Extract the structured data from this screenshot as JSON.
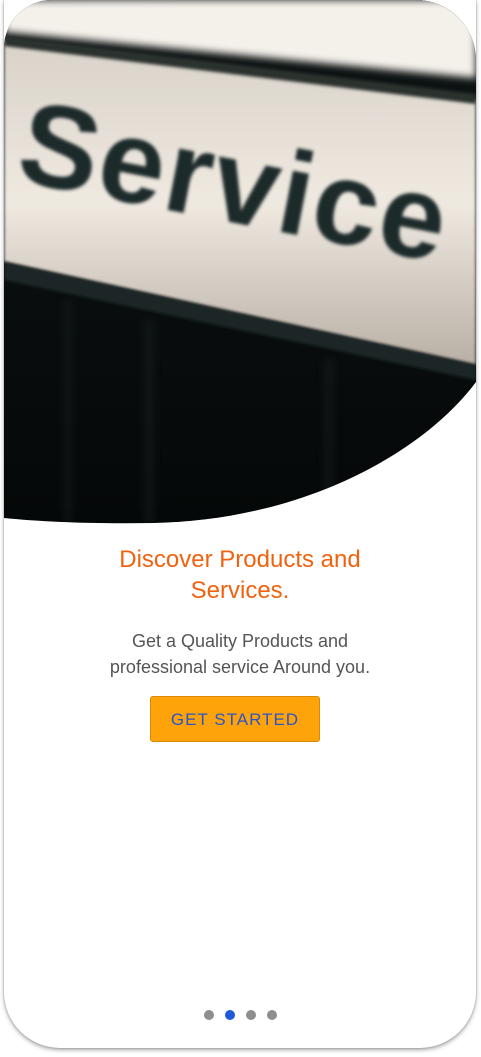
{
  "hero": {
    "sign_text": "Service",
    "icon": "service-sign-photo"
  },
  "onboarding": {
    "title_line1": "Discover Products and",
    "title_line2": "Services.",
    "subtitle_line1": "Get a Quality Products and",
    "subtitle_line2": "professional service Around you.",
    "cta_label": "GET STARTED"
  },
  "pagination": {
    "total_pages": 4,
    "active_index": 1
  },
  "colors": {
    "title": "#f06210",
    "cta_bg": "#ffa30a",
    "cta_text": "#2a54c9",
    "dot_active": "#1f5ad8",
    "dot_inactive": "#8e8e8e"
  }
}
